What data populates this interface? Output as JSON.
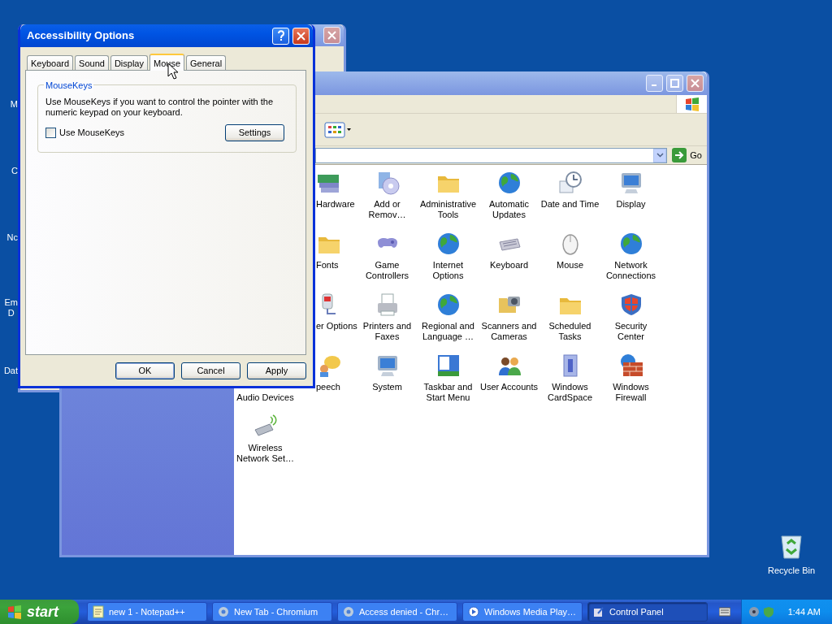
{
  "desktop_icons": [
    {
      "label": "M"
    },
    {
      "label": "C"
    },
    {
      "label": "Nc"
    },
    {
      "label": "Em\nD"
    },
    {
      "label": "Dat"
    }
  ],
  "recycle_bin": {
    "label": "Recycle Bin"
  },
  "control_panel": {
    "go_button": "Go",
    "rows": [
      [
        "",
        {
          "label": "Hardware"
        },
        {
          "label": "Add or\nRemov…"
        },
        {
          "label": "Administrative\nTools"
        },
        {
          "label": "Automatic\nUpdates"
        },
        {
          "label": "Date and Time"
        },
        {
          "label": "Display"
        }
      ],
      [
        "",
        {
          "label": "Fonts"
        },
        {
          "label": "Game\nControllers"
        },
        {
          "label": "Internet\nOptions"
        },
        {
          "label": "Keyboard"
        },
        {
          "label": "Mouse"
        },
        {
          "label": "Network\nConnections"
        }
      ],
      [
        "",
        {
          "label": "er Options"
        },
        {
          "label": "Printers and\nFaxes"
        },
        {
          "label": "Regional and\nLanguage …"
        },
        {
          "label": "Scanners and\nCameras"
        },
        {
          "label": "Scheduled\nTasks"
        },
        {
          "label": "Security\nCenter"
        }
      ],
      [
        {
          "label": "Audio Devices"
        },
        {
          "label": "peech"
        },
        {
          "label": "System"
        },
        {
          "label": "Taskbar and\nStart Menu"
        },
        {
          "label": "User Accounts"
        },
        {
          "label": "Windows\nCardSpace"
        },
        {
          "label": "Windows\nFirewall"
        }
      ],
      [
        {
          "label": "Wireless\nNetwork Set…"
        }
      ]
    ]
  },
  "dialog": {
    "title": "Accessibility Options",
    "tabs": [
      {
        "label": "Keyboard",
        "selected": false
      },
      {
        "label": "Sound",
        "selected": false
      },
      {
        "label": "Display",
        "selected": false
      },
      {
        "label": "Mouse",
        "selected": true
      },
      {
        "label": "General",
        "selected": false
      }
    ],
    "mousekeys": {
      "title": "MouseKeys",
      "description": "Use MouseKeys if you want to control the pointer with the numeric keypad on your keyboard.",
      "checkbox": {
        "label": "Use MouseKeys",
        "checked": false
      },
      "settings_button": "Settings"
    },
    "buttons": [
      {
        "label": "OK",
        "default": true
      },
      {
        "label": "Cancel",
        "default": false
      },
      {
        "label": "Apply",
        "default": false
      }
    ]
  },
  "taskbar": {
    "start": "start",
    "tasks": [
      {
        "label": "new 1 - Notepad++",
        "selected": false
      },
      {
        "label": "New Tab - Chromium",
        "selected": false
      },
      {
        "label": "Access denied - Chr…",
        "selected": false
      },
      {
        "label": "Windows Media Play…",
        "selected": false
      },
      {
        "label": "Control Panel",
        "selected": true
      }
    ],
    "clock": "1:44 AM"
  }
}
